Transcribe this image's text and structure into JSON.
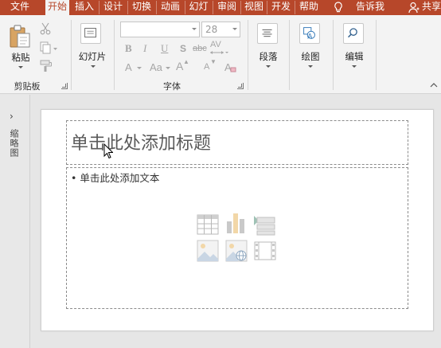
{
  "tabs": [
    {
      "label": "文件",
      "active": false
    },
    {
      "label": "开始",
      "active": true
    },
    {
      "label": "插入",
      "active": false
    },
    {
      "label": "设计",
      "active": false
    },
    {
      "label": "切换",
      "active": false
    },
    {
      "label": "动画",
      "active": false
    },
    {
      "label": "幻灯",
      "active": false
    },
    {
      "label": "审阅",
      "active": false
    },
    {
      "label": "视图",
      "active": false
    },
    {
      "label": "开发",
      "active": false
    },
    {
      "label": "帮助",
      "active": false
    }
  ],
  "tell_me": {
    "label": "告诉我",
    "icon": "lightbulb-icon"
  },
  "share": {
    "label": "共享",
    "icon": "person-icon"
  },
  "ribbon": {
    "clipboard": {
      "paste_label": "粘贴",
      "group_label": "剪贴板",
      "icons": [
        "paste-icon",
        "cut-icon",
        "copy-icon",
        "format-painter-icon"
      ]
    },
    "slides": {
      "new_slide_label": "幻灯片",
      "icon": "new-slide-icon"
    },
    "font": {
      "group_label": "字体",
      "font_name": "",
      "font_size": "28",
      "bold": "B",
      "italic": "I",
      "underline": "U",
      "shadow": "S",
      "strikethrough": "abc",
      "char_spacing": "AV",
      "change_case": "Aa",
      "grow": "A",
      "shrink": "A",
      "clear": "A"
    },
    "paragraph": {
      "label": "段落",
      "icon": "paragraph-icon"
    },
    "drawing": {
      "label": "绘图",
      "icon": "shapes-icon"
    },
    "editing": {
      "label": "编辑",
      "icon": "search-icon"
    }
  },
  "thumbs_pane": {
    "label": "缩略图",
    "expand_icon": "chevron-right-icon",
    "arrow": "›"
  },
  "slide": {
    "title_placeholder": "单击此处添加标题",
    "body_placeholder": "• 单击此处添加文本",
    "content_icons": [
      "table-icon",
      "chart-icon",
      "smartart-icon",
      "picture-icon",
      "online-picture-icon",
      "video-icon"
    ]
  },
  "colors": {
    "accent": "#b7472a",
    "ribbon_bg": "#f3f3f3",
    "workspace_bg": "#e6e6e6"
  }
}
